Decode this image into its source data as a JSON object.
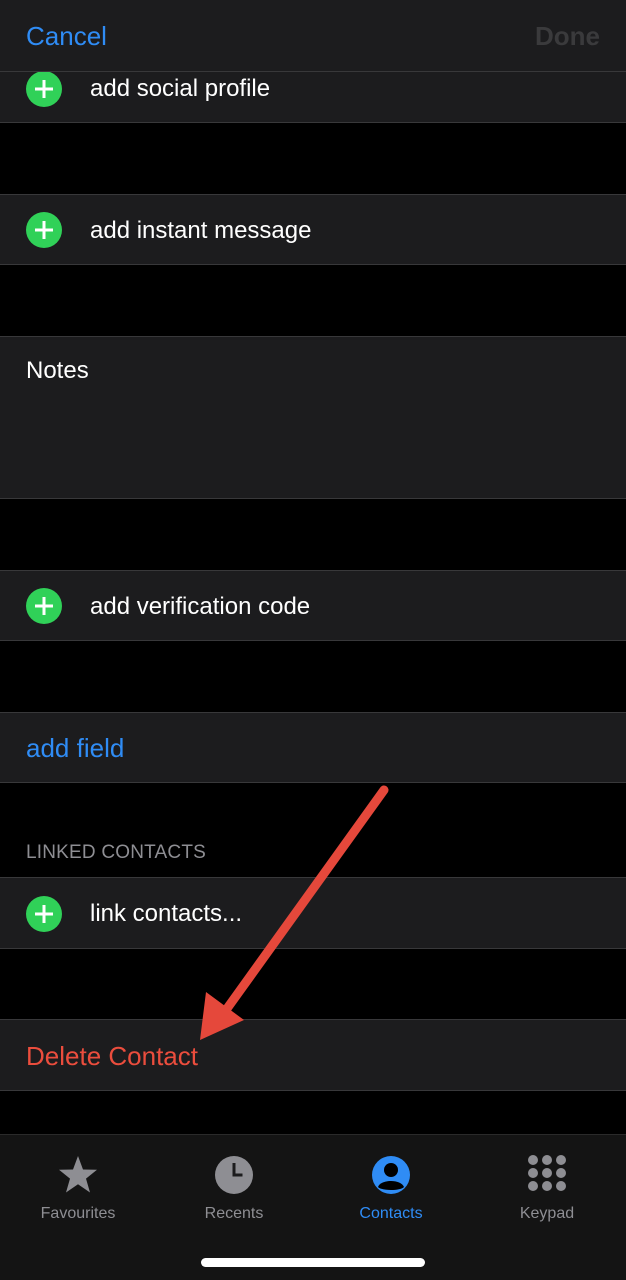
{
  "navbar": {
    "cancel_label": "Cancel",
    "done_label": "Done"
  },
  "rows": {
    "social_profile": "add social profile",
    "instant_message": "add instant message",
    "notes_label": "Notes",
    "verification_code": "add verification code",
    "add_field": "add field",
    "linked_contacts_header": "LINKED CONTACTS",
    "link_contacts": "link contacts...",
    "delete_contact": "Delete Contact"
  },
  "tabbar": {
    "tabs": [
      {
        "label": "Favourites",
        "icon": "star-icon"
      },
      {
        "label": "Recents",
        "icon": "clock-icon"
      },
      {
        "label": "Contacts",
        "icon": "person-circle-icon",
        "selected": true
      },
      {
        "label": "Keypad",
        "icon": "keypad-icon"
      }
    ]
  },
  "colors": {
    "accent_blue": "#2f8cf5",
    "destructive_red": "#eb4d3d",
    "add_green": "#30d158",
    "annotation_arrow": "#e5483b"
  }
}
